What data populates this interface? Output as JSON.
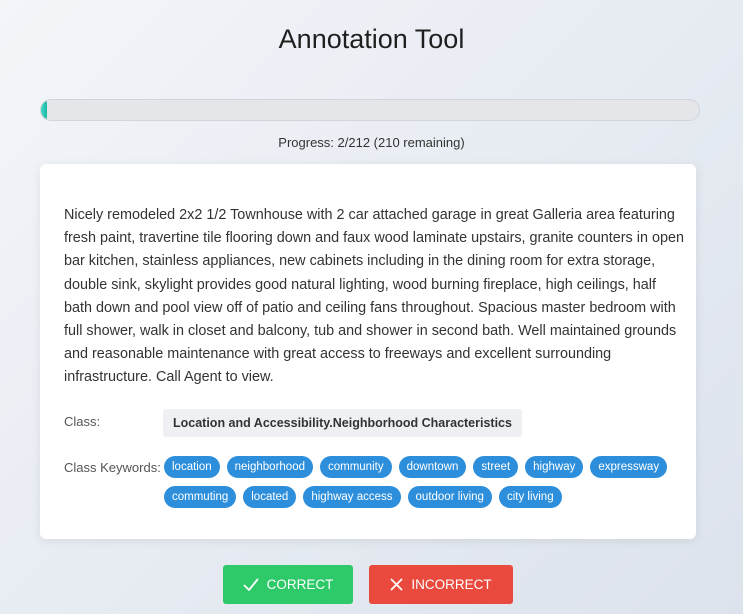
{
  "header": {
    "title": "Annotation Tool"
  },
  "progress": {
    "current": 2,
    "total": 212,
    "fraction": 0.0094,
    "text": "Progress: 2/212 (210 remaining)"
  },
  "item": {
    "description": "Nicely remodeled 2x2 1/2 Townhouse with 2 car attached garage in great Galleria area featuring fresh paint, travertine tile flooring down and faux wood laminate upstairs, granite counters in open bar kitchen, stainless appliances, new cabinets including in the dining room for extra storage, double sink, skylight provides good natural lighting, wood burning fireplace, high ceilings, half bath down and pool view off of patio and ceiling fans throughout. Spacious master bedroom with full shower, walk in closet and balcony, tub and shower in second bath. Well maintained grounds and reasonable maintenance with great access to freeways and excellent surrounding infrastructure. Call Agent to view.",
    "class_label": "Class:",
    "class_value": "Location and Accessibility.Neighborhood Characteristics",
    "keywords_label": "Class Keywords:",
    "keywords": [
      "location",
      "neighborhood",
      "community",
      "downtown",
      "street",
      "highway",
      "expressway",
      "commuting",
      "located",
      "highway access",
      "outdoor living",
      "city living"
    ]
  },
  "actions": {
    "correct_label": "CORRECT",
    "incorrect_label": "INCORRECT",
    "correct_icon": "check-icon",
    "incorrect_icon": "x-icon"
  },
  "colors": {
    "progress": "#1fb5a5",
    "keyword_chip": "#2d8fdb",
    "correct": "#2ec968",
    "incorrect": "#ea4a3d"
  }
}
